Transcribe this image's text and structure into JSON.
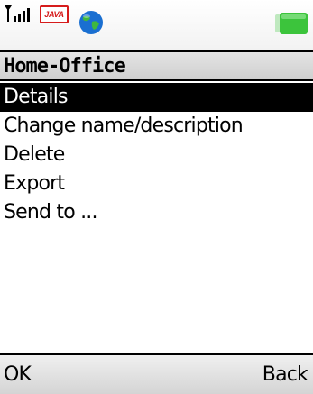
{
  "status_bar": {
    "signal_icon": "signal-strength-icon",
    "java_badge": "JAVA",
    "network_icon": "globe-icon",
    "battery_icon": "battery-icon",
    "colors": {
      "java": "#d61c1c",
      "globe": "#1a6fd1",
      "battery": "#3cc43c"
    }
  },
  "title": "Home-Office",
  "menu": {
    "selected_index": 0,
    "items": [
      {
        "label": "Details"
      },
      {
        "label": "Change name/description"
      },
      {
        "label": "Delete"
      },
      {
        "label": "Export"
      },
      {
        "label": "Send to ..."
      }
    ]
  },
  "softkeys": {
    "left": "OK",
    "right": "Back"
  }
}
